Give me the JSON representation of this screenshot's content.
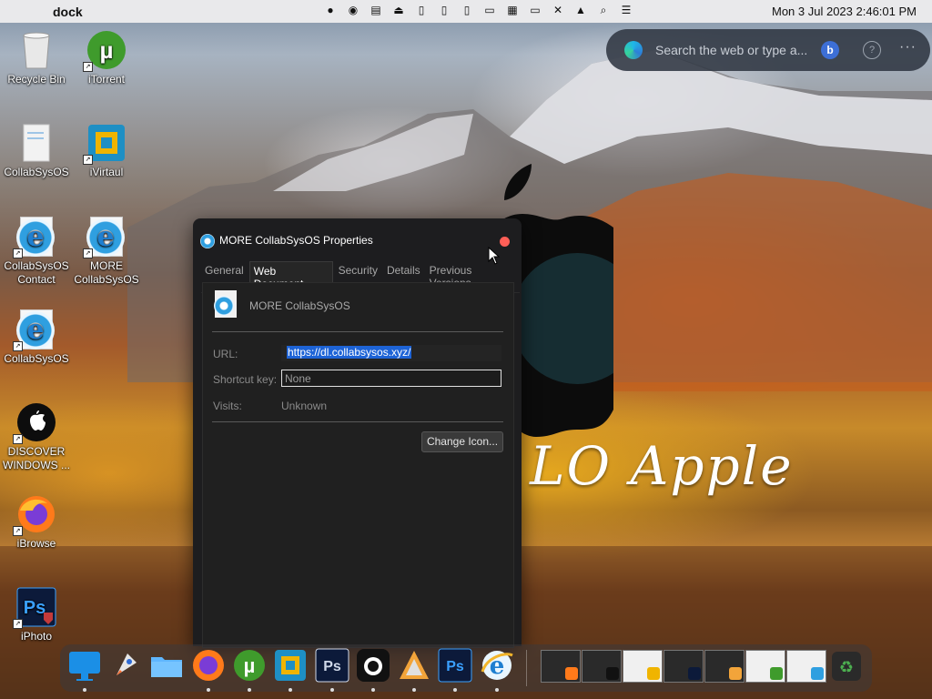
{
  "menubar": {
    "app_name": "dock",
    "clock": "Mon 3 Jul 2023  2:46:01 PM"
  },
  "edge_bar": {
    "placeholder": "Search the web or type a...",
    "bing_glyph": "b",
    "help_glyph": "?",
    "more_glyph": "···"
  },
  "desktop": {
    "icons": [
      {
        "label": "Recycle Bin",
        "icon": "recycle-bin-icon"
      },
      {
        "label": "iTorrent",
        "icon": "utorrent-icon"
      },
      {
        "label": "CollabSysOS",
        "icon": "document-icon"
      },
      {
        "label": "iVirtaul",
        "icon": "virtualbox-icon"
      },
      {
        "label": "CollabSysOS Contact",
        "icon": "ie-shortcut-icon"
      },
      {
        "label": "MORE CollabSysOS",
        "icon": "ie-shortcut-icon"
      },
      {
        "label": "CollabSysOS",
        "icon": "ie-shortcut-icon"
      },
      {
        "label": "DISCOVER WINDOWS ...",
        "icon": "apple-circle-icon"
      },
      {
        "label": "iBrowse",
        "icon": "firefox-icon"
      },
      {
        "label": "iPhoto",
        "icon": "photoshop-icon"
      }
    ]
  },
  "wallpaper": {
    "text": "LO Apple"
  },
  "dialog": {
    "title": "MORE CollabSysOS Properties",
    "tabs": [
      "General",
      "Web Document",
      "Security",
      "Details",
      "Previous Versions"
    ],
    "active_tab": "Web Document",
    "doc_name": "MORE CollabSysOS",
    "url_label": "URL:",
    "url_value": "https://dl.collabsysos.xyz/",
    "shortcut_label": "Shortcut key:",
    "shortcut_value": "None",
    "visits_label": "Visits:",
    "visits_value": "Unknown",
    "change_icon_label": "Change Icon..."
  },
  "dock": {
    "apps": [
      "Finder",
      "Launchpad",
      "Files",
      "Firefox",
      "uTorrent",
      "VirtualBox",
      "Photoshop",
      "Apple",
      "Affinity",
      "Photoshop",
      "Internet Explorer"
    ],
    "accent": "#1d63d6"
  }
}
